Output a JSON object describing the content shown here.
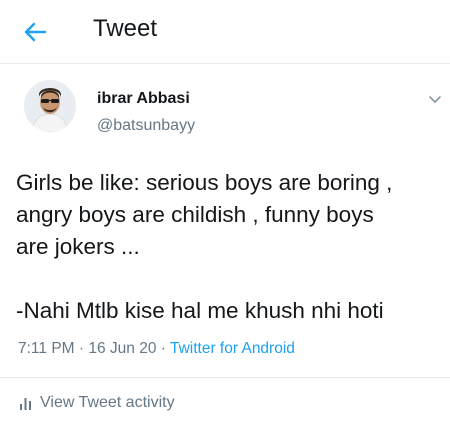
{
  "header": {
    "title": "Tweet",
    "back_icon": "arrow-left-icon"
  },
  "author": {
    "name": "ibrar Abbasi",
    "handle": "@batsunbayy"
  },
  "tweet": {
    "lines": [
      "Girls be like: serious boys are boring ,",
      "angry boys are childish , funny boys",
      "are jokers ...",
      "-Nahi Mtlb kise hal me khush nhi hoti"
    ]
  },
  "meta": {
    "time": "7:11 PM",
    "separator": "·",
    "date": "16 Jun 20",
    "source": "Twitter for Android"
  },
  "activity": {
    "label": "View Tweet activity",
    "icon": "analytics-icon"
  },
  "colors": {
    "accent": "#1da1f2",
    "muted": "#657786",
    "text": "#14171a",
    "border": "#e6ecf0"
  }
}
